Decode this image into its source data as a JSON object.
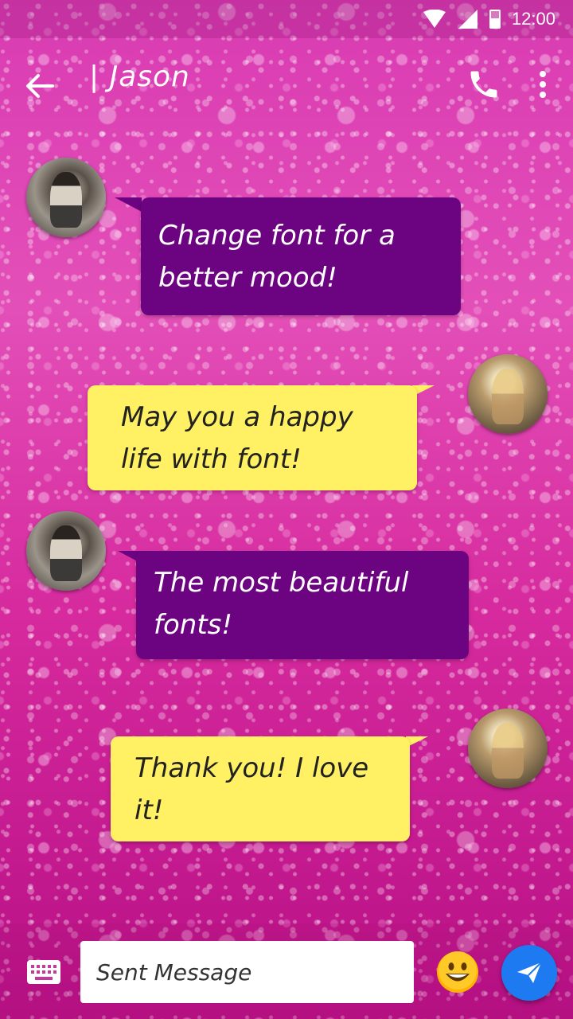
{
  "status_bar": {
    "time": "12:00"
  },
  "header": {
    "title": "| Jason"
  },
  "messages": [
    {
      "direction": "incoming",
      "sender": "Jason",
      "text": "Change font for a better mood!"
    },
    {
      "direction": "outgoing",
      "text": "May you a happy life with font!"
    },
    {
      "direction": "incoming",
      "sender": "Jason",
      "text": "The most beautiful fonts!"
    },
    {
      "direction": "outgoing",
      "text": "Thank you! I love it!"
    }
  ],
  "composer": {
    "placeholder": "Sent Message"
  },
  "icons": {
    "back": "arrow-left-icon",
    "call": "phone-icon",
    "more": "more-vert-icon",
    "keyboard": "keyboard-icon",
    "emoji": "smiley-emoji-icon",
    "send": "send-icon",
    "wifi": "wifi-icon",
    "signal": "signal-icon",
    "battery": "battery-icon"
  },
  "colors": {
    "incoming_bubble": "#6c0481",
    "outgoing_bubble": "#fff064",
    "send_button": "#1e7af0"
  }
}
